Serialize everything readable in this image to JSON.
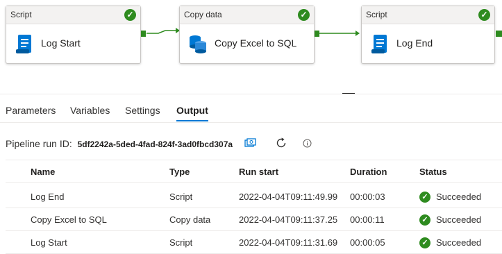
{
  "pipeline": {
    "activities": [
      {
        "type_label": "Script",
        "name": "Log Start",
        "icon": "script-icon",
        "status_icon": "success-check-icon"
      },
      {
        "type_label": "Copy data",
        "name": "Copy Excel to SQL",
        "icon": "copy-data-icon",
        "status_icon": "success-check-icon"
      },
      {
        "type_label": "Script",
        "name": "Log End",
        "icon": "script-icon",
        "status_icon": "success-check-icon"
      }
    ],
    "success_color": "#2e8b1f"
  },
  "tabs": {
    "parameters": "Parameters",
    "variables": "Variables",
    "settings": "Settings",
    "output": "Output",
    "active": "Output"
  },
  "run": {
    "label": "Pipeline run ID:",
    "id": "5df2242a-5ded-4fad-824f-3ad0fbcd307a",
    "copy_icon": "copy-icon",
    "refresh_icon": "refresh-icon",
    "info_icon": "info-icon"
  },
  "table": {
    "headers": {
      "name": "Name",
      "type": "Type",
      "run_start": "Run start",
      "duration": "Duration",
      "status": "Status"
    },
    "rows": [
      {
        "name": "Log End",
        "type": "Script",
        "run_start": "2022-04-04T09:11:49.998",
        "duration": "00:00:03",
        "status": "Succeeded"
      },
      {
        "name": "Copy Excel to SQL",
        "type": "Copy data",
        "run_start": "2022-04-04T09:11:37.256",
        "duration": "00:00:11",
        "status": "Succeeded"
      },
      {
        "name": "Log Start",
        "type": "Script",
        "run_start": "2022-04-04T09:11:31.694",
        "duration": "00:00:05",
        "status": "Succeeded"
      }
    ]
  }
}
